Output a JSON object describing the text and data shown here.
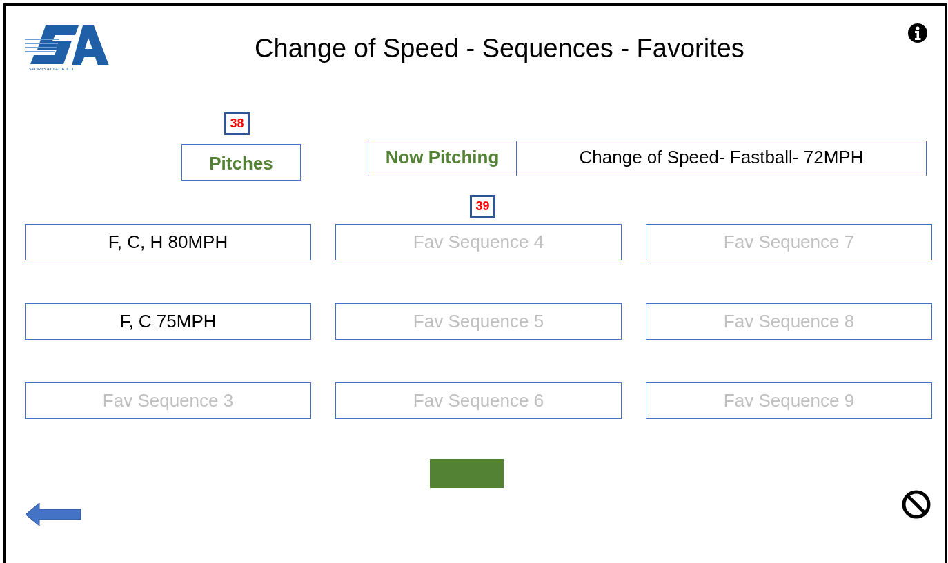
{
  "header": {
    "logo_text": "SPORTSATTACK LLC",
    "title": "Change of Speed - Sequences - Favorites"
  },
  "pitches": {
    "count": "38",
    "label": "Pitches"
  },
  "now_pitching": {
    "label": "Now Pitching",
    "value": "Change of Speed- Fastball- 72MPH",
    "count": "39"
  },
  "sequences": [
    {
      "label": "F, C, H 80MPH",
      "disabled": false
    },
    {
      "label": "Fav Sequence 4",
      "disabled": true
    },
    {
      "label": "Fav Sequence 7",
      "disabled": true
    },
    {
      "label": "F, C 75MPH",
      "disabled": false
    },
    {
      "label": "Fav Sequence 5",
      "disabled": true
    },
    {
      "label": "Fav Sequence 8",
      "disabled": true
    },
    {
      "label": "Fav Sequence 3",
      "disabled": true
    },
    {
      "label": "Fav Sequence 6",
      "disabled": true
    },
    {
      "label": "Fav Sequence 9",
      "disabled": true
    }
  ]
}
